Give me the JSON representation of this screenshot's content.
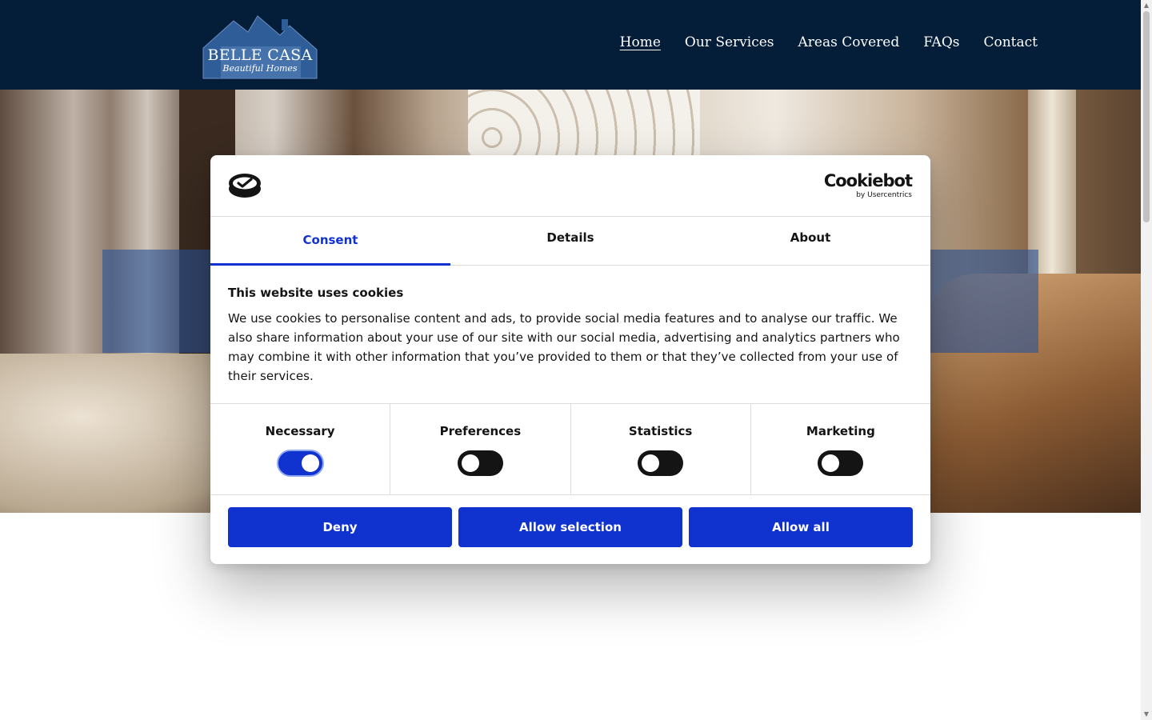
{
  "header": {
    "logo": {
      "name": "BELLE CASA",
      "tagline": "Beautiful Homes"
    },
    "nav": [
      {
        "label": "Home",
        "active": true
      },
      {
        "label": "Our Services"
      },
      {
        "label": "Areas Covered"
      },
      {
        "label": "FAQs"
      },
      {
        "label": "Contact"
      }
    ]
  },
  "cookie_dialog": {
    "brand": {
      "name": "Cookiebot",
      "byline": "by Usercentrics"
    },
    "tabs": [
      {
        "label": "Consent",
        "active": true
      },
      {
        "label": "Details"
      },
      {
        "label": "About"
      }
    ],
    "title": "This website uses cookies",
    "description": "We use cookies to personalise content and ads, to provide social media features and to analyse our traffic. We also share information about your use of our site with our social media, advertising and analytics partners who may combine it with other information that you’ve provided to them or that they’ve collected from your use of their services.",
    "categories": [
      {
        "label": "Necessary",
        "enabled": true
      },
      {
        "label": "Preferences",
        "enabled": false
      },
      {
        "label": "Statistics",
        "enabled": false
      },
      {
        "label": "Marketing",
        "enabled": false
      }
    ],
    "buttons": {
      "deny": "Deny",
      "allow_selection": "Allow selection",
      "allow_all": "Allow all"
    }
  },
  "colors": {
    "header_bg": "#041e3a",
    "accent": "#1032cf",
    "banner_overlay": "#2c5496"
  }
}
